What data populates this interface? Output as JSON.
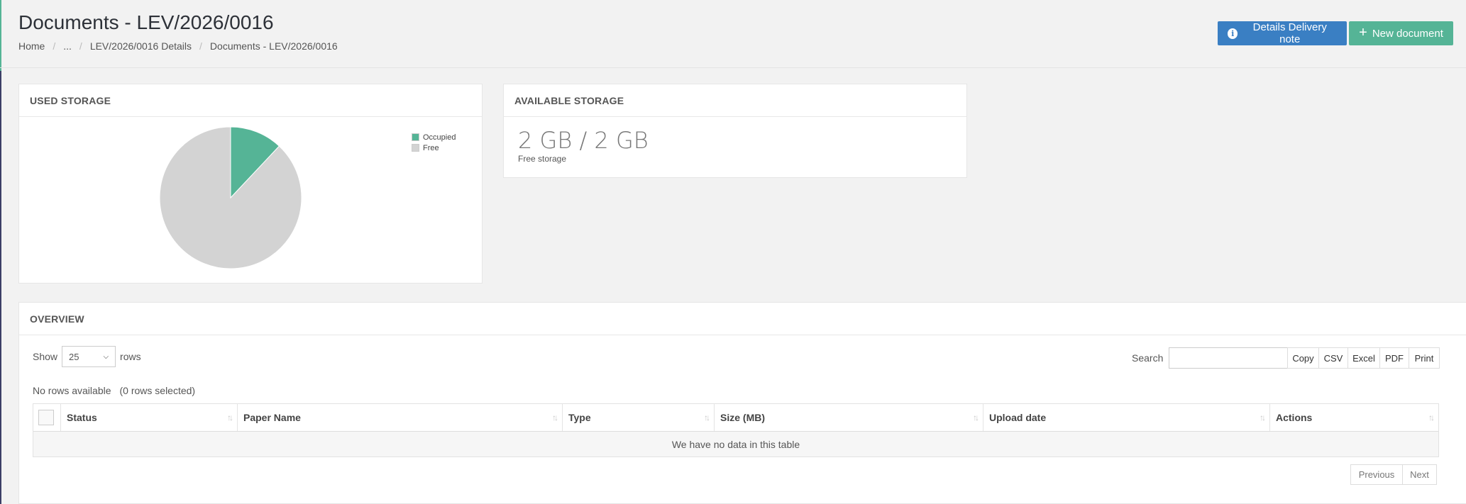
{
  "header": {
    "title": "Documents - LEV/2026/0016",
    "breadcrumb": [
      "Home",
      "...",
      "LEV/2026/0016 Details",
      "Documents - LEV/2026/0016"
    ],
    "actions": {
      "details_label": "Details Delivery note",
      "new_label": "New document"
    }
  },
  "used_storage": {
    "title": "USED STORAGE",
    "chart_data": {
      "type": "pie",
      "labels": [
        "Occupied",
        "Free"
      ],
      "values": [
        12,
        88
      ],
      "colors": [
        "#55b496",
        "#d3d3d3"
      ],
      "legend_position": "top-right"
    }
  },
  "available_storage": {
    "title": "AVAILABLE STORAGE",
    "value": "2 GB / 2 GB",
    "label": "Free storage"
  },
  "overview": {
    "title": "OVERVIEW",
    "show_label": "Show",
    "rows_label": "rows",
    "page_size": "25",
    "search_label": "Search",
    "search_value": "",
    "export_buttons": [
      "Copy",
      "CSV",
      "Excel",
      "PDF",
      "Print"
    ],
    "info": "No rows available",
    "selected_info": "(0 rows selected)",
    "columns": [
      "Status",
      "Paper Name",
      "Type",
      "Size (MB)",
      "Upload date",
      "Actions"
    ],
    "empty_message": "We have no data in this table",
    "pager": {
      "previous": "Previous",
      "next": "Next"
    }
  },
  "colors": {
    "primary": "#3a7fc3",
    "success": "#55b496",
    "background": "#f2f2f2"
  }
}
